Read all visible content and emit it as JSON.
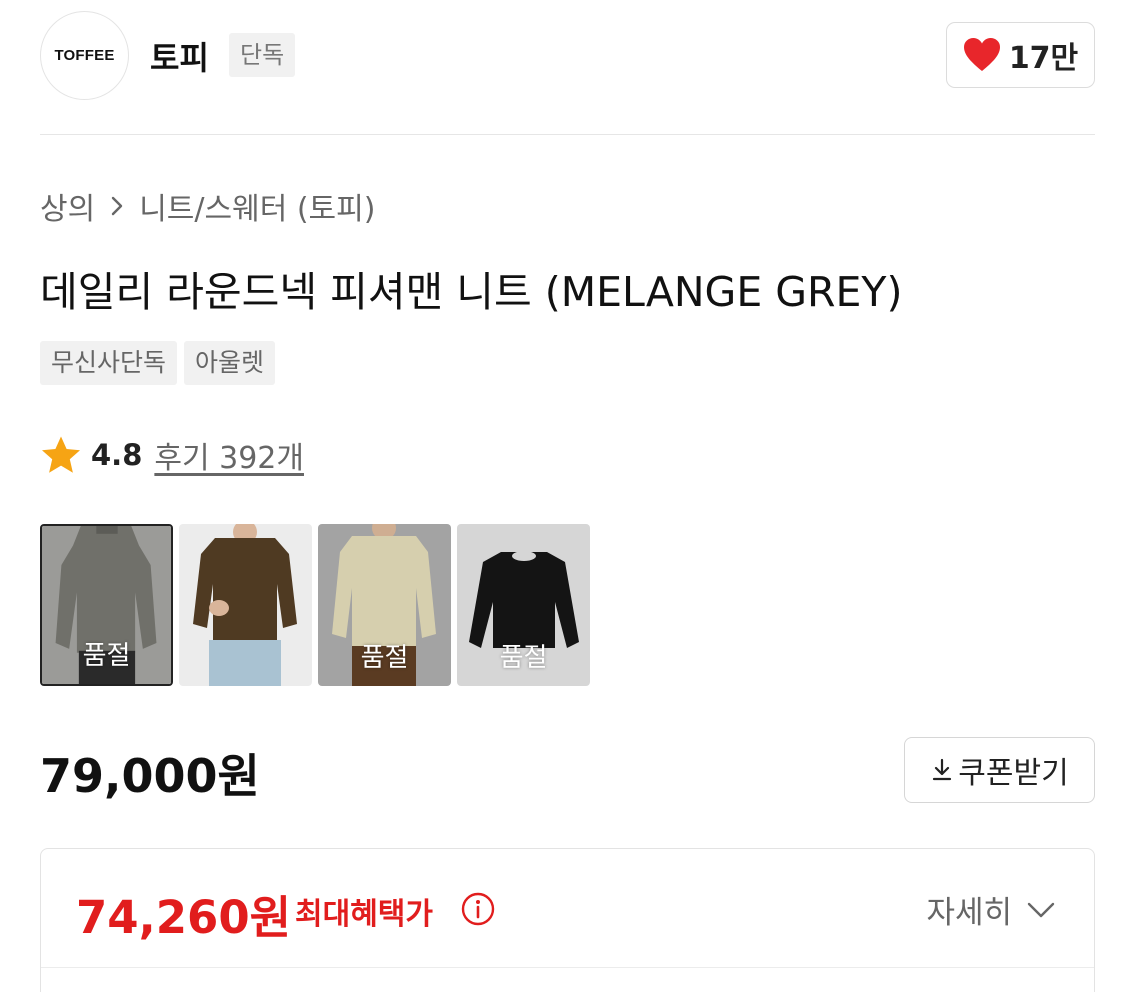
{
  "brand": {
    "logo_text": "TOFFEE",
    "name": "토피",
    "tag": "단독",
    "likes": "17만",
    "like_icon": "heart-icon",
    "like_color": "#e8262b"
  },
  "breadcrumb": {
    "category": "상의",
    "separator_icon": "chevron-right-icon",
    "subcategory": "니트/스웨터 (토피)"
  },
  "product": {
    "title": "데일리 라운드넥 피셔맨 니트 (MELANGE GREY)",
    "badges": [
      "무신사단독",
      "아울렛"
    ],
    "rating": "4.8",
    "star_color": "#f6a414",
    "reviews": "후기 392개"
  },
  "thumbnails": [
    {
      "label": "품절",
      "color": "melange grey",
      "selected": true
    },
    {
      "label": "",
      "color": "brown",
      "selected": false
    },
    {
      "label": "품절",
      "color": "oatmeal",
      "selected": false
    },
    {
      "label": "품절",
      "color": "black",
      "selected": false
    }
  ],
  "pricing": {
    "price": "79,000원",
    "coupon_label": "쿠폰받기",
    "coupon_icon": "download-icon",
    "benefit_price": "74,260원",
    "benefit_label": "최대혜택가",
    "benefit_color": "#e11d1d",
    "info_icon": "info-icon",
    "details_label": "자세히",
    "details_icon": "chevron-down-icon"
  }
}
